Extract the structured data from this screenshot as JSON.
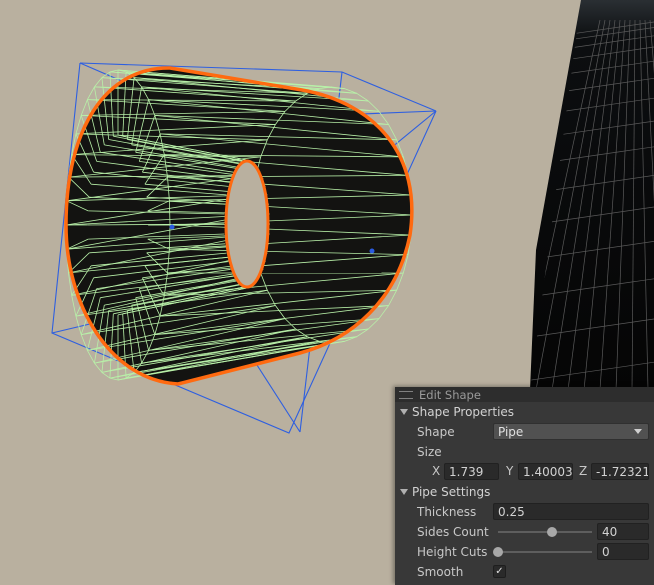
{
  "panel": {
    "title": "Edit Shape",
    "shape_properties": {
      "header": "Shape Properties",
      "shape_label": "Shape",
      "shape_value": "Pipe",
      "size_label": "Size",
      "x_label": "X",
      "x_value": "1.739",
      "y_label": "Y",
      "y_value": "1.40003",
      "z_label": "Z",
      "z_value": "-1.72321"
    },
    "pipe_settings": {
      "header": "Pipe Settings",
      "thickness_label": "Thickness",
      "thickness_value": "0.25",
      "sides_label": "Sides Count",
      "sides_value": "40",
      "sides_fraction": 0.57,
      "height_cuts_label": "Height Cuts",
      "height_cuts_value": "0",
      "height_cuts_fraction": 0.0,
      "smooth_label": "Smooth",
      "smooth_checked": "✓"
    }
  },
  "colors": {
    "ground": "#b9b09f",
    "selection_outline": "#ff6a10",
    "wireframe": "#b8f0a8",
    "bounds": "#2e5fe0",
    "panel_bg": "#383838"
  }
}
